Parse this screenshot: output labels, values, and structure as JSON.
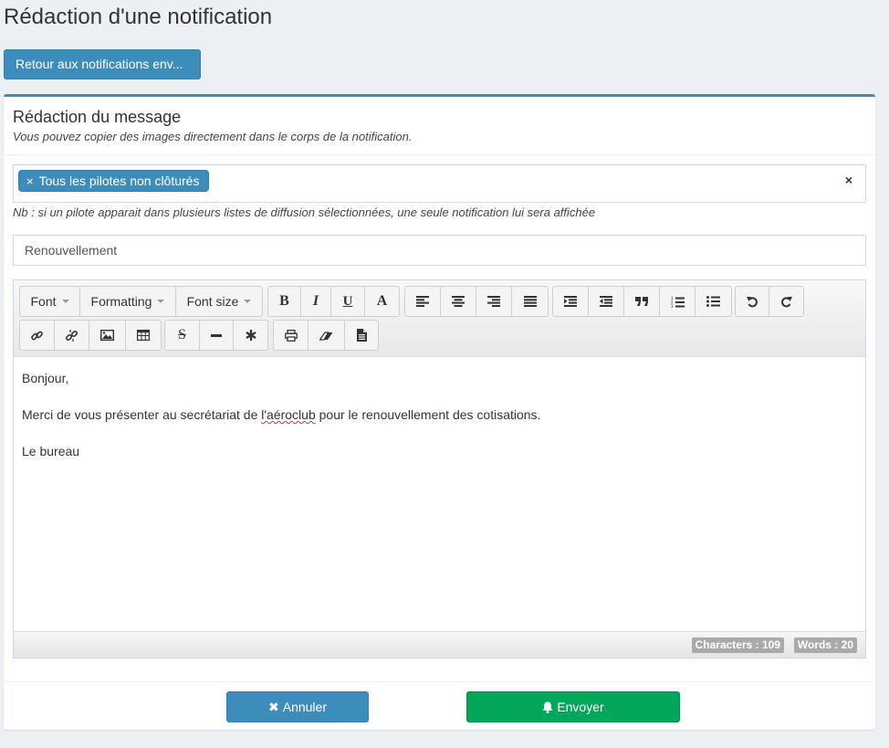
{
  "page": {
    "title": "Rédaction d'une notification",
    "back_button": "Retour aux notifications env..."
  },
  "box": {
    "title": "Rédaction du message",
    "subtitle": "Vous pouvez copier des images directement dans le corps de la notification."
  },
  "recipients": {
    "tags": [
      {
        "label": "Tous les pilotes non clôturés",
        "remove": "×"
      }
    ],
    "clear": "×",
    "note": "Nb : si un pilote apparait dans plusieurs listes de diffusion sélectionnées, une seule notification lui sera affichée"
  },
  "subject": {
    "value": "Renouvellement"
  },
  "editor": {
    "toolbar": {
      "font": "Font",
      "formatting": "Formatting",
      "font_size": "Font size"
    },
    "content": {
      "line1": "Bonjour,",
      "line2_before": "Merci de vous présenter au secrétariat de ",
      "line2_misspelled": "l'aéroclub",
      "line2_after": " pour le renouvellement des cotisations.",
      "line3": "Le bureau"
    },
    "status": {
      "characters": "Characters : 109",
      "words": "Words : 20"
    }
  },
  "footer": {
    "cancel": "Annuler",
    "send": "Envoyer"
  },
  "icons": {
    "toolbar_row1": [
      "bold-icon",
      "italic-icon",
      "underline-icon",
      "font-color-icon",
      "align-left-icon",
      "align-center-icon",
      "align-right-icon",
      "align-justify-icon",
      "indent-icon",
      "outdent-icon",
      "blockquote-icon",
      "ordered-list-icon",
      "unordered-list-icon",
      "undo-icon",
      "redo-icon"
    ],
    "toolbar_row2": [
      "link-icon",
      "unlink-icon",
      "image-icon",
      "table-icon",
      "strikethrough-icon",
      "horizontal-rule-icon",
      "special-char-icon",
      "print-icon",
      "clear-format-icon",
      "source-icon"
    ]
  },
  "colors": {
    "primary": "#3c8dbc",
    "success": "#00a65a",
    "background": "#ecf0f5"
  }
}
